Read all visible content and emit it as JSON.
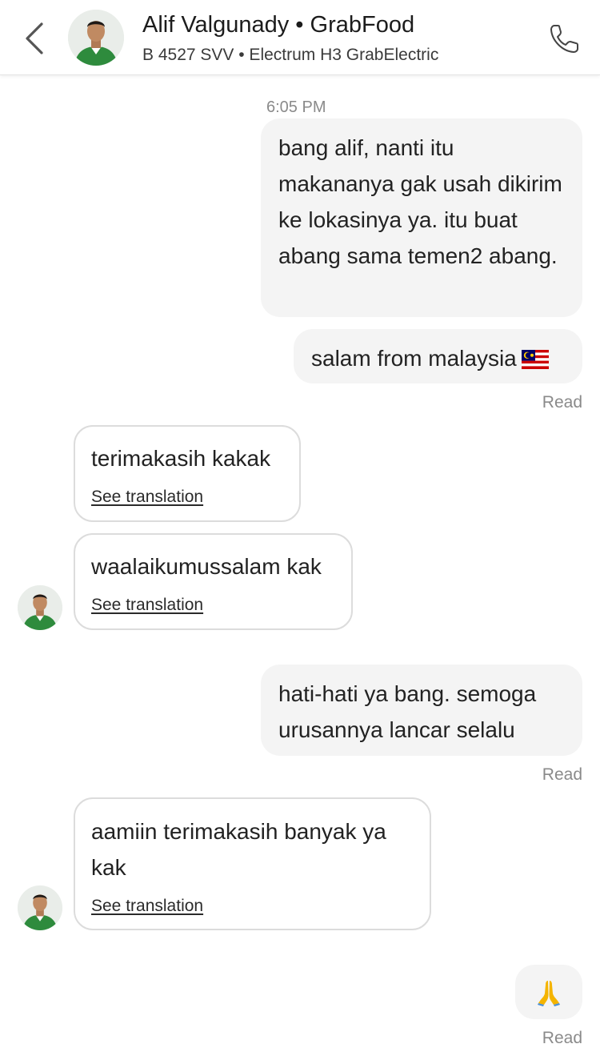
{
  "header": {
    "title": "Alif Valgunady • GrabFood",
    "subtitle": "B 4527 SVV • Electrum H3 GrabElectric"
  },
  "chat": {
    "timestamp": "6:05 PM",
    "see_translation_label": "See translation",
    "read_label": "Read",
    "messages": [
      {
        "direction": "outgoing",
        "text": "bang alif, nanti itu makananya gak usah dikirim ke lokasinya ya. itu buat abang sama temen2 abang."
      },
      {
        "direction": "outgoing",
        "text": "salam from malaysia",
        "emoji": "malaysia-flag"
      },
      {
        "direction": "incoming",
        "text": "terimakasih kakak"
      },
      {
        "direction": "incoming",
        "text": "waalaikumussalam kak"
      },
      {
        "direction": "outgoing",
        "text": "hati-hati ya bang. semoga urusannya lancar selalu"
      },
      {
        "direction": "incoming",
        "text": "aamiin terimakasih banyak ya kak"
      },
      {
        "direction": "outgoing",
        "text": "🙏"
      }
    ]
  },
  "icons": {
    "back": "chevron-left-icon",
    "call": "phone-icon"
  },
  "colors": {
    "outgoing_bubble": "#f4f4f4",
    "incoming_border": "#dcdcdc",
    "muted_text": "#8a8a8a",
    "driver_jacket": "#2e8b3d"
  }
}
